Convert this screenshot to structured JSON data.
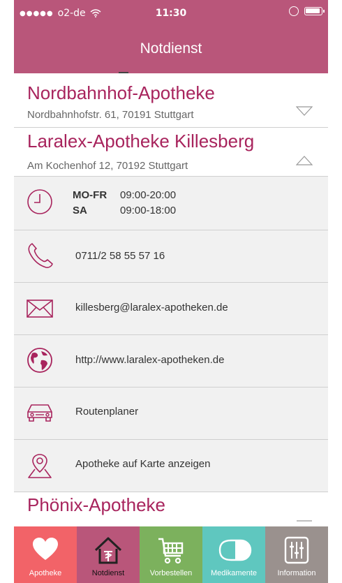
{
  "status_bar": {
    "signal": "●●●●●",
    "carrier": "o2-de",
    "time": "11:30"
  },
  "header": {
    "title": "Notdienst"
  },
  "pharmacies": [
    {
      "name": "Nordbahnhof-Apotheke",
      "address": "Nordbahnhofstr. 61, 70191 Stuttgart",
      "expanded": false
    },
    {
      "name": "Laralex-Apotheke Killesberg",
      "address": "Am Kochenhof 12, 70192 Stuttgart",
      "expanded": true
    },
    {
      "name": "Phönix-Apotheke",
      "address": "",
      "expanded": false
    }
  ],
  "details": {
    "hours": [
      {
        "days": "MO-FR",
        "time": "09:00-20:00"
      },
      {
        "days": "SA",
        "time": "09:00-18:00"
      }
    ],
    "phone": "0711/2 58 55 57 16",
    "email": "killesberg@laralex-apotheken.de",
    "website": "http://www.laralex-apotheken.de",
    "route": "Routenplaner",
    "map": "Apotheke auf Karte anzeigen"
  },
  "tabs": [
    {
      "label": "Apotheke",
      "icon": "heart-icon",
      "color": "#f26368",
      "active": false
    },
    {
      "label": "Notdienst",
      "icon": "pharmacy-house-icon",
      "color": "#b9567a",
      "active": true
    },
    {
      "label": "Vorbestellen",
      "icon": "cart-icon",
      "color": "#7cb15d",
      "active": false
    },
    {
      "label": "Medikamente",
      "icon": "pill-icon",
      "color": "#5fc7bf",
      "active": false
    },
    {
      "label": "Information",
      "icon": "sliders-icon",
      "color": "#9a918e",
      "active": false
    }
  ],
  "colors": {
    "accent": "#b9567a",
    "name_text": "#a8245d",
    "icon_stroke": "#a8245d"
  }
}
